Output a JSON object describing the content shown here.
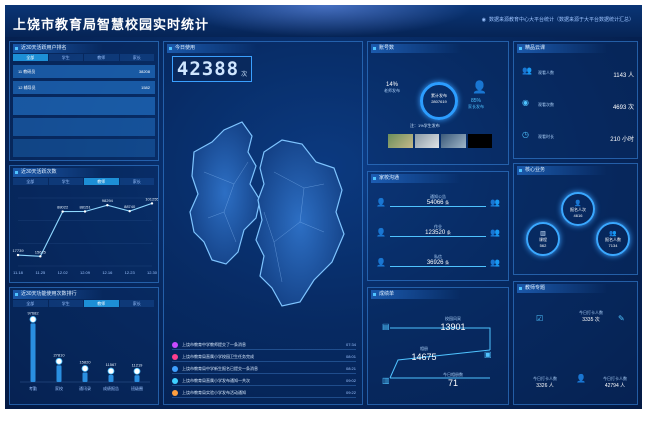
{
  "header": {
    "title": "上饶市教育局智慧校园实时统计",
    "note": "数据来源教育中心大平台统计（数据来源于大平台数据统计汇总）"
  },
  "left_top": {
    "title": "近30天活跃用户排名",
    "tabs": [
      "全部",
      "学生",
      "教师",
      "家长"
    ],
    "rows": [
      {
        "rank": "11",
        "name": "教研员",
        "value": "38208"
      },
      {
        "rank": "12",
        "name": "辅导员",
        "value": "1582"
      }
    ]
  },
  "left_mid": {
    "title": "近30天活跃次数",
    "tabs": [
      "全部",
      "学生",
      "教师",
      "家长"
    ],
    "active_tab": 2
  },
  "left_bottom": {
    "title": "近30天功能使用次数排行",
    "tabs": [
      "全部",
      "学生",
      "教师",
      "家长"
    ],
    "active_tab": 2
  },
  "center": {
    "title": "今日使用",
    "counter": "42388",
    "unit": "次"
  },
  "news": [
    {
      "text": "上饶市教育中学教师提交了一条消息",
      "time": "07:34",
      "color": "#c94bff"
    },
    {
      "text": "上饶市教育局直属小学校园卫生任务完成",
      "time": "08:01",
      "color": "#ff3f8e"
    },
    {
      "text": "上饶市教育局中学新生报名已提交一条消息",
      "time": "08:21",
      "color": "#3fa0ff"
    },
    {
      "text": "上饶市教育局直属小学发布通知一共次",
      "time": "09:02",
      "color": "#3fd0ff"
    },
    {
      "text": "上饶市教育局实验小学发布活动通知",
      "time": "09:22",
      "color": "#ff9f3f"
    }
  ],
  "right1": {
    "title": "账号数",
    "pct_left": "14%",
    "pct_left_label": "老师发布",
    "pct_right": "85%",
    "pct_right_label": "家长发布",
    "center_label": "累计发布",
    "center_value": "2807619",
    "note": "注：1%学生发布"
  },
  "right2": {
    "title": "家校沟通",
    "items": [
      {
        "label": "通知公告",
        "value": "54066",
        "unit": "条"
      },
      {
        "label": "作业",
        "value": "123520",
        "unit": "条"
      },
      {
        "label": "私信",
        "value": "36926",
        "unit": "条"
      }
    ]
  },
  "right3": {
    "title": "成绩单",
    "items": [
      {
        "label": "校园风采",
        "value": "13901"
      },
      {
        "label": "相册",
        "value": "14675"
      },
      {
        "label": "今日相册数",
        "value": "71"
      }
    ]
  },
  "far1": {
    "title": "精品云课",
    "items": [
      {
        "label": "观看人数",
        "value": "1143",
        "unit": "人"
      },
      {
        "label": "观看次数",
        "value": "4693",
        "unit": "次"
      },
      {
        "label": "观看时长",
        "value": "210",
        "unit": "小时"
      }
    ]
  },
  "far2": {
    "title": "核心业务",
    "items": [
      {
        "label": "报名人次",
        "value": "4616"
      },
      {
        "label": "课程",
        "value": "562"
      },
      {
        "label": "报名人数",
        "value": "7134"
      }
    ]
  },
  "far3": {
    "title": "教师专题",
    "items": [
      {
        "label": "今日打卡人数",
        "value": "3335",
        "unit": "次"
      },
      {
        "label": "今日打卡人数",
        "value": "3326",
        "unit": "人"
      },
      {
        "label": "今日打卡人数",
        "value": "42794",
        "unit": "人"
      }
    ]
  },
  "chart_data": [
    {
      "type": "line",
      "x": [
        "11.18",
        "11.25",
        "12.02",
        "12.09",
        "12.16",
        "12.23",
        "12.30"
      ],
      "series": [
        {
          "name": "",
          "values": [
            17739,
            15625,
            88022,
            88151,
            98294,
            88740,
            101255
          ]
        }
      ],
      "ylim": [
        0,
        110000
      ]
    },
    {
      "type": "bar",
      "categories": [
        "考勤",
        "家校",
        "通讯录",
        "成绩报告",
        "班级圈"
      ],
      "values": [
        97682,
        27810,
        15820,
        11567,
        11219
      ]
    }
  ]
}
